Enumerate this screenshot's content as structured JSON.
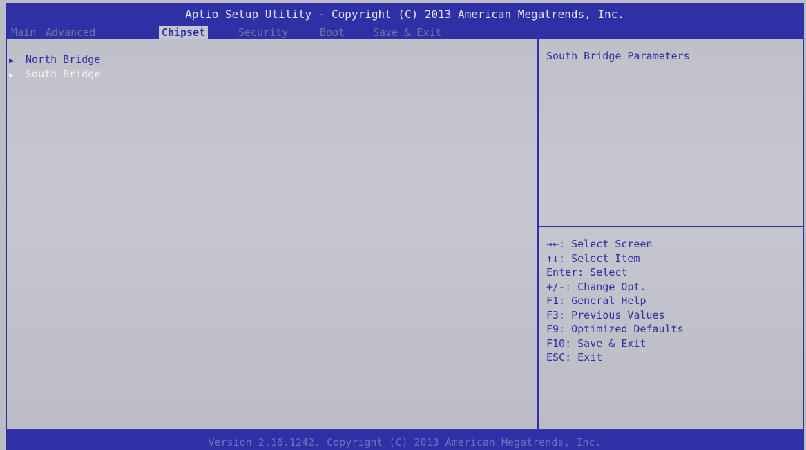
{
  "header": {
    "title": "Aptio Setup Utility - Copyright (C) 2013 American Megatrends, Inc.",
    "tabs": [
      {
        "label": "Main"
      },
      {
        "label": "Advanced"
      },
      {
        "label": "Chipset"
      },
      {
        "label": "Security"
      },
      {
        "label": "Boot"
      },
      {
        "label": "Save & Exit"
      }
    ],
    "active_tab": "Chipset"
  },
  "menu": {
    "items": [
      {
        "label": "North Bridge",
        "arrow": "▶"
      },
      {
        "label": "South Bridge",
        "arrow": "▶"
      }
    ],
    "selected": "South Bridge"
  },
  "help": {
    "description": "South Bridge Parameters",
    "keys": [
      "→←: Select Screen",
      "↑↓: Select Item",
      "Enter: Select",
      "+/-: Change Opt.",
      "F1: General Help",
      "F3: Previous Values",
      "F9: Optimized Defaults",
      "F10: Save & Exit",
      "ESC: Exit"
    ]
  },
  "footer": {
    "text": "Version 2.16.1242. Copyright (C) 2013 American Megatrends, Inc."
  },
  "colors": {
    "primary_blue": "#2f2fa6",
    "background_gray": "#bcbcc6",
    "highlight_white": "#f2f2f8",
    "inactive_tab": "#6c76a6"
  }
}
